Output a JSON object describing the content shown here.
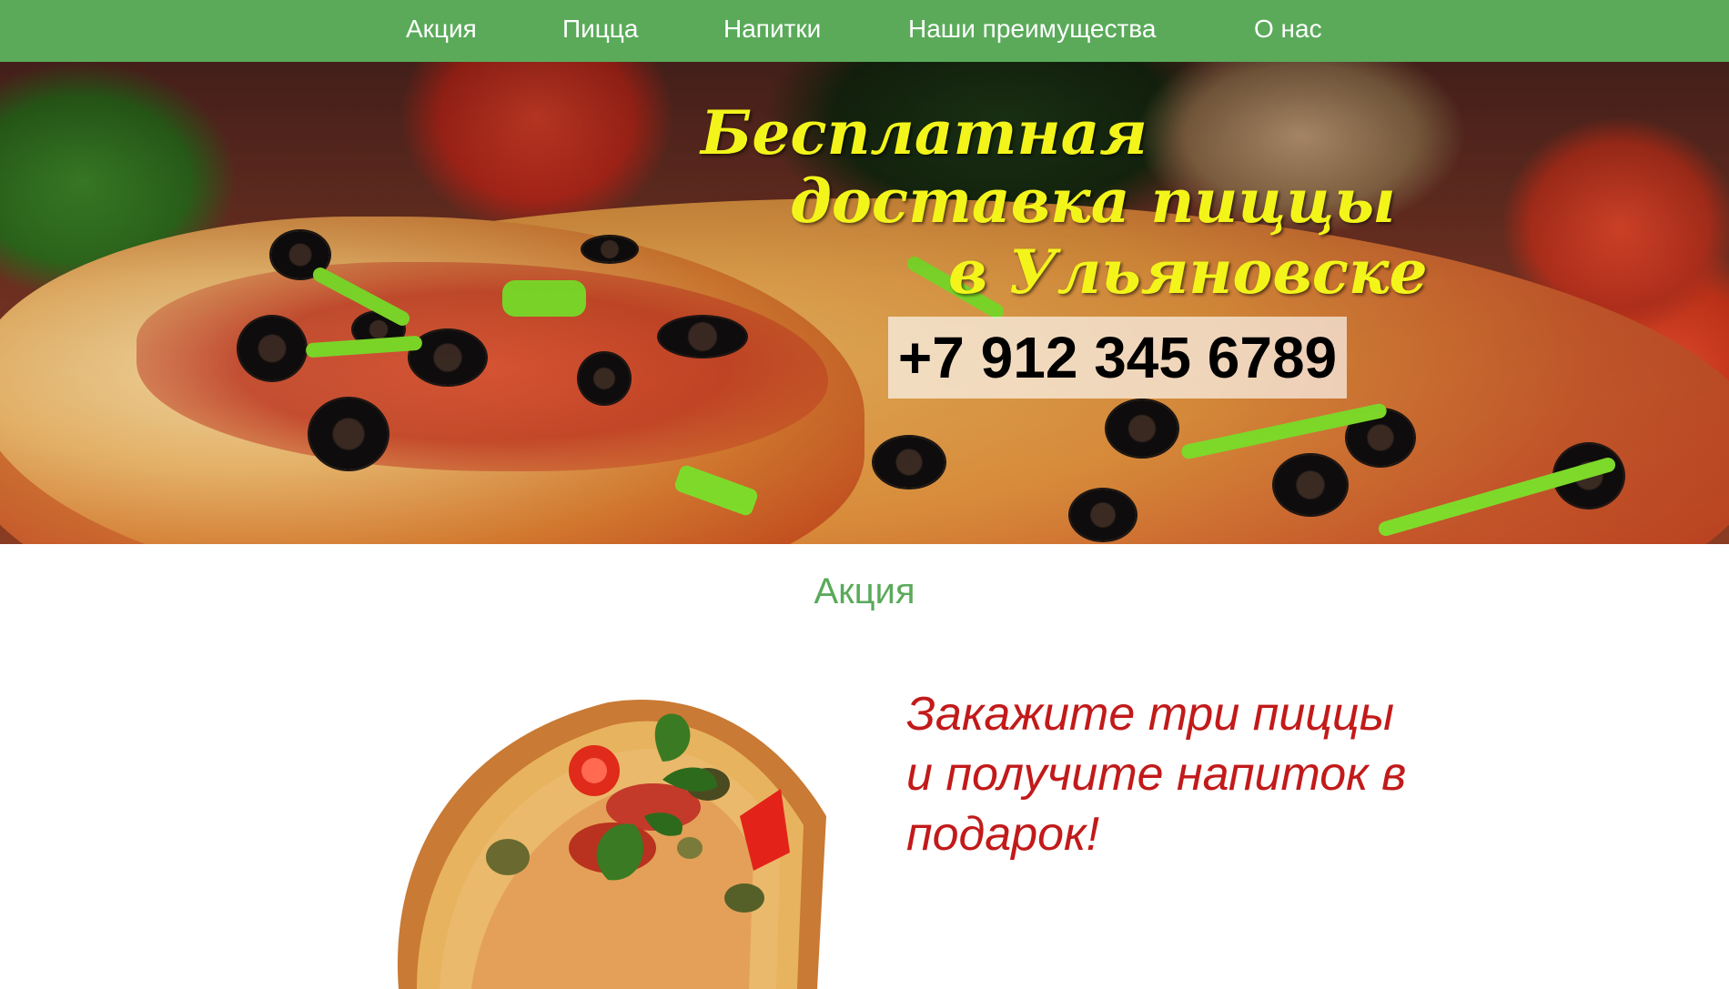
{
  "nav": {
    "items": [
      {
        "label": "Акция"
      },
      {
        "label": "Пицца"
      },
      {
        "label": "Напитки"
      },
      {
        "label": "Наши преимущества"
      },
      {
        "label": "О нас"
      }
    ]
  },
  "hero": {
    "title_line1": "Бесплатная",
    "title_line2": "доставка пиццы",
    "title_line3": "в Ульяновске",
    "phone": "+7 912 345 6789"
  },
  "promo": {
    "section_title": "Акция",
    "text": "Закажите три пиццы и получите напиток в подарок!"
  },
  "colors": {
    "nav_bg": "#5aaa5a",
    "accent_green": "#5aaa5a",
    "hero_title": "#f3f51a",
    "promo_red": "#c21a1a"
  },
  "icons": {
    "hero_image": "pizza-photo",
    "promo_image": "pizza-slice-photo"
  }
}
